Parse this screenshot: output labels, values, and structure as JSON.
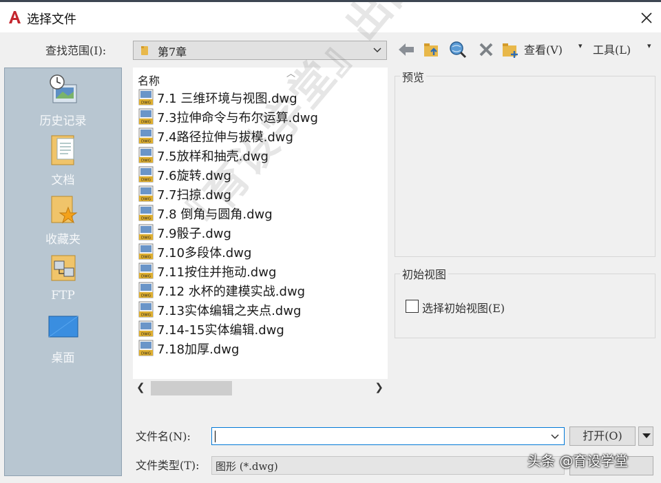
{
  "window": {
    "title": "选择文件"
  },
  "toolbar": {
    "lookin_label": "查找范围(I):",
    "lookin_value": "第7章",
    "view_label": "查看(V)",
    "tools_label": "工具(L)"
  },
  "places": [
    {
      "label": "历史记录"
    },
    {
      "label": "文档"
    },
    {
      "label": "收藏夹"
    },
    {
      "label": "FTP"
    },
    {
      "label": "桌面"
    }
  ],
  "filelist": {
    "column_name": "名称",
    "files": [
      "7.1 三维环境与视图.dwg",
      "7.3拉伸命令与布尔运算.dwg",
      "7.4路径拉伸与拔模.dwg",
      "7.5放样和抽壳.dwg",
      "7.6旋转.dwg",
      "7.7扫掠.dwg",
      "7.8 倒角与圆角.dwg",
      "7.9骰子.dwg",
      "7.10多段体.dwg",
      "7.11按住并拖动.dwg",
      "7.12 水杯的建模实战.dwg",
      "7.13实体编辑之夹点.dwg",
      "7.14-15实体编辑.dwg",
      "7.18加厚.dwg"
    ]
  },
  "preview": {
    "title": "预览"
  },
  "initial_view": {
    "title": "初始视图",
    "checkbox_label": "选择初始视图(E)",
    "checked": false
  },
  "bottom": {
    "filename_label": "文件名(N):",
    "filename_value": "",
    "open_label": "打开(O)",
    "filetype_label": "文件类型(T):",
    "filetype_value": "图形 (*.dwg)"
  },
  "watermark": {
    "diagonal": "『育设学堂』出品",
    "corner": "头条 @育设学堂"
  },
  "colors": {
    "accent": "#0078d7",
    "places_bg": "#b8c6d1",
    "app_icon": "#c4262e"
  }
}
